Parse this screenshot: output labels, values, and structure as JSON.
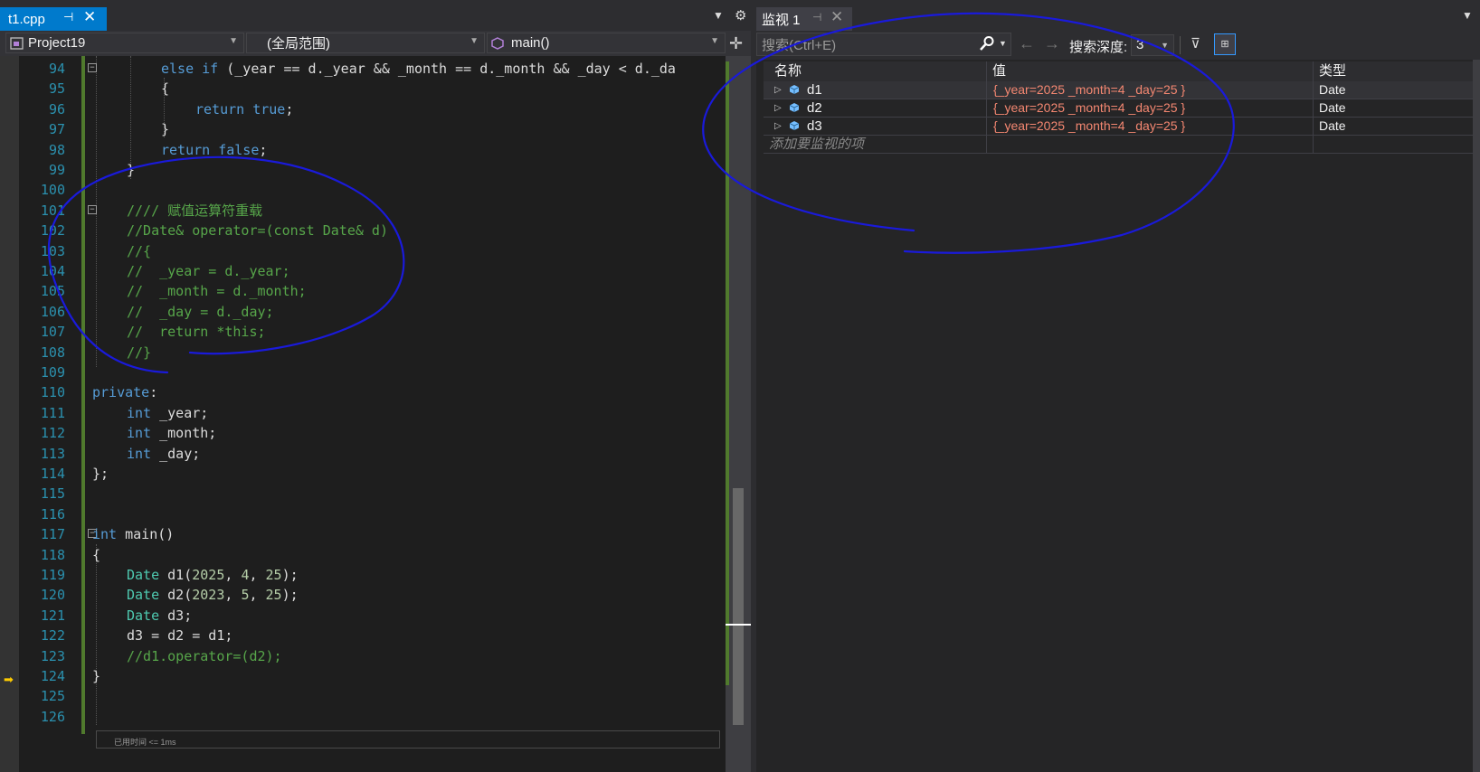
{
  "editor": {
    "tab": {
      "label": "t1.cpp",
      "pin_glyph": "⊣",
      "close_glyph": "✕"
    },
    "toolbar_glyphs": {
      "dropdown": "▼",
      "settings": "⚙",
      "split": "✛"
    },
    "navbar": {
      "project": "Project19",
      "scope": "(全局范围)",
      "function": "main()"
    },
    "current_line_hint": "已用时间 <= 1ms",
    "exec_arrow_glyph": "➡"
  },
  "code_lines": [
    {
      "n": "94",
      "text": "else if (_year == d._year && _month == d._month && _day < d._da"
    },
    {
      "n": "95",
      "text": "{"
    },
    {
      "n": "96",
      "text": "return true;"
    },
    {
      "n": "97",
      "text": "}"
    },
    {
      "n": "98",
      "text": "return false;"
    },
    {
      "n": "99",
      "text": "}"
    },
    {
      "n": "100",
      "text": ""
    },
    {
      "n": "101",
      "text": "//// 赋值运算符重载"
    },
    {
      "n": "102",
      "text": "//Date& operator=(const Date& d)"
    },
    {
      "n": "103",
      "text": "//{"
    },
    {
      "n": "104",
      "text": "//  _year = d._year;"
    },
    {
      "n": "105",
      "text": "//  _month = d._month;"
    },
    {
      "n": "106",
      "text": "//  _day = d._day;"
    },
    {
      "n": "107",
      "text": "//  return *this;"
    },
    {
      "n": "108",
      "text": "//}"
    },
    {
      "n": "109",
      "text": ""
    },
    {
      "n": "110",
      "text": "private:"
    },
    {
      "n": "111",
      "text": "int _year;"
    },
    {
      "n": "112",
      "text": "int _month;"
    },
    {
      "n": "113",
      "text": "int _day;"
    },
    {
      "n": "114",
      "text": "};"
    },
    {
      "n": "115",
      "text": ""
    },
    {
      "n": "116",
      "text": ""
    },
    {
      "n": "117",
      "text": "int main()"
    },
    {
      "n": "118",
      "text": "{"
    },
    {
      "n": "119",
      "text": "Date d1(2025, 4, 25);"
    },
    {
      "n": "120",
      "text": "Date d2(2023, 5, 25);"
    },
    {
      "n": "121",
      "text": "Date d3;"
    },
    {
      "n": "122",
      "text": "d3 = d2 = d1;"
    },
    {
      "n": "123",
      "text": "//d1.operator=(d2);"
    },
    {
      "n": "124",
      "text": "}"
    },
    {
      "n": "125",
      "text": ""
    },
    {
      "n": "126",
      "text": ""
    }
  ],
  "watch": {
    "tab": {
      "label": "监视 1",
      "pin_glyph": "⊣",
      "close_glyph": "✕"
    },
    "dropdown_glyph": "▼",
    "search_placeholder": "搜索(Ctrl+E)",
    "search_icon_glyph": "⚲",
    "back_glyph": "←",
    "forward_glyph": "→",
    "depth_label": "搜索深度:",
    "depth_value": "3",
    "filter_glyph": "⊽",
    "view_glyph": "⊞",
    "columns": {
      "name": "名称",
      "value": "值",
      "type": "类型"
    },
    "rows": [
      {
        "name": "d1",
        "value": "{_year=2025 _month=4 _day=25 }",
        "type": "Date"
      },
      {
        "name": "d2",
        "value": "{_year=2025 _month=4 _day=25 }",
        "type": "Date"
      },
      {
        "name": "d3",
        "value": "{_year=2025 _month=4 _day=25 }",
        "type": "Date"
      }
    ],
    "add_item_placeholder": "添加要监视的项"
  },
  "colors": {
    "accent": "#007acc",
    "keyword": "#569cd6",
    "comment": "#57a64a",
    "type": "#4ec9b0",
    "number": "#b5cea8",
    "line_number": "#2b91af",
    "changed_value": "#f48771",
    "annotation_ink": "#1a1adb"
  }
}
